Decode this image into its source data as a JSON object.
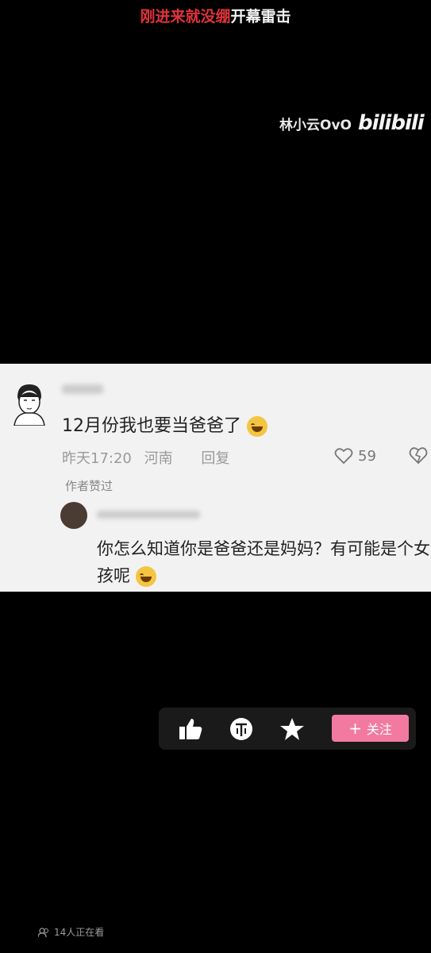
{
  "danmaku": {
    "red_text": "刚进来就没绷",
    "white_text": "开幕雷击"
  },
  "watermark": {
    "user": "林小云OvO",
    "logo": "bilibili"
  },
  "comment1": {
    "text": "12月份我也要当爸爸了",
    "time": "昨天17:20",
    "location": "河南",
    "reply_label": "回复",
    "likes": "59",
    "author_liked": "作者赞过"
  },
  "comment2": {
    "text": "你怎么知道你是爸爸还是妈妈？有可能是个女孩呢"
  },
  "toolbar": {
    "follow_label": "关注"
  },
  "viewers": {
    "text": "14人正在看"
  },
  "colors": {
    "accent_pink": "#f27aa0",
    "danmaku_red": "#e0333a"
  }
}
